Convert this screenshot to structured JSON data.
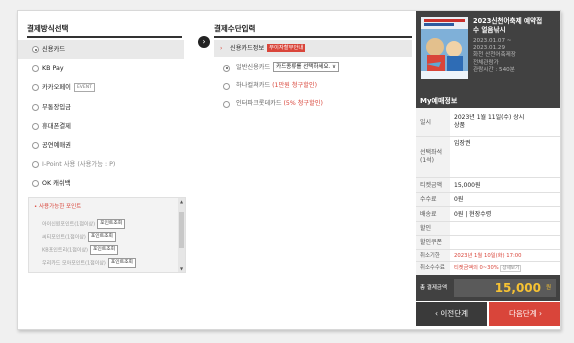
{
  "left": {
    "title": "결제방식선택",
    "methods": [
      {
        "label": "신용카드",
        "tag": ""
      },
      {
        "label": "KB Pay",
        "tag": ""
      },
      {
        "label": "카카오페이",
        "tag": "EVENT"
      },
      {
        "label": "무통장입금",
        "tag": ""
      },
      {
        "label": "휴대폰결제",
        "tag": ""
      },
      {
        "label": "공연예매권",
        "tag": ""
      },
      {
        "label": "I-Point 사용 (사용가능 : P)",
        "tag": ""
      },
      {
        "label": "OK 캐쉬백",
        "tag": ""
      }
    ],
    "points": {
      "title": "• 사용가능한 포인트",
      "rows": [
        {
          "label": "아이신원포인트(1점이상)",
          "button": "포인트조회"
        },
        {
          "label": "씨티포인트(1점이상)",
          "button": "포인트조회"
        },
        {
          "label": "KB포인트리(1점이상)",
          "button": "포인트조회"
        },
        {
          "label": "우리카드 모아포인트(1점이상)",
          "button": "포인트조회"
        }
      ]
    }
  },
  "middle": {
    "title": "결제수단입력",
    "card_info_label": "신용카드정보",
    "card_info_badge": "무이자할부안내",
    "general_card_label": "일반신용카드",
    "card_select_placeholder": "카드종류를 선택하세요.",
    "hana_label": "하나컬쳐카드",
    "hana_discount": "(1만원 청구할인)",
    "interpark_label": "인터파크롯데카드",
    "interpark_discount": "(5% 청구할인)"
  },
  "right": {
    "poster": {
      "title_line1": "2023신천어축제 예약접",
      "title_line2": "수 얼음낚시",
      "date_line1": "2023.01.07 ~",
      "date_line2": "2023.01.29",
      "venue_line1": "화천 산천어축제장",
      "venue_line2": "전체관람가",
      "venue_line3": "관람시간 : 540분"
    },
    "my_info_title": "My예매정보",
    "rows": {
      "date": {
        "key": "일시",
        "val1": "2023년 1월 11일(수) 상시",
        "val2": "상품"
      },
      "seat": {
        "key1": "선택좌석",
        "key2": "(1석)",
        "val": "입장권"
      },
      "ticket": {
        "key": "티켓금액",
        "val": "15,000원"
      },
      "fee": {
        "key": "수수료",
        "val": "0원"
      },
      "delivery": {
        "key": "배송료",
        "val": "0원 | 현장수령"
      },
      "discount": {
        "key": "할인",
        "val": ""
      },
      "coupon": {
        "key": "할인쿠폰",
        "val": ""
      },
      "deadline": {
        "key": "취소기한",
        "val": "2023년 1월 10일(화) 17:00"
      },
      "cancel_fee": {
        "key": "취소수수료",
        "val": "티켓금액의 0~30%",
        "link": "상세보기"
      }
    },
    "total_label": "총 결제금액",
    "total_amount": "15,000",
    "total_unit": "원",
    "prev_button": "이전단계",
    "next_button": "다음단계",
    "colors": {
      "accent": "#d9453a",
      "dark": "#414141",
      "total": "#f6c233"
    }
  }
}
